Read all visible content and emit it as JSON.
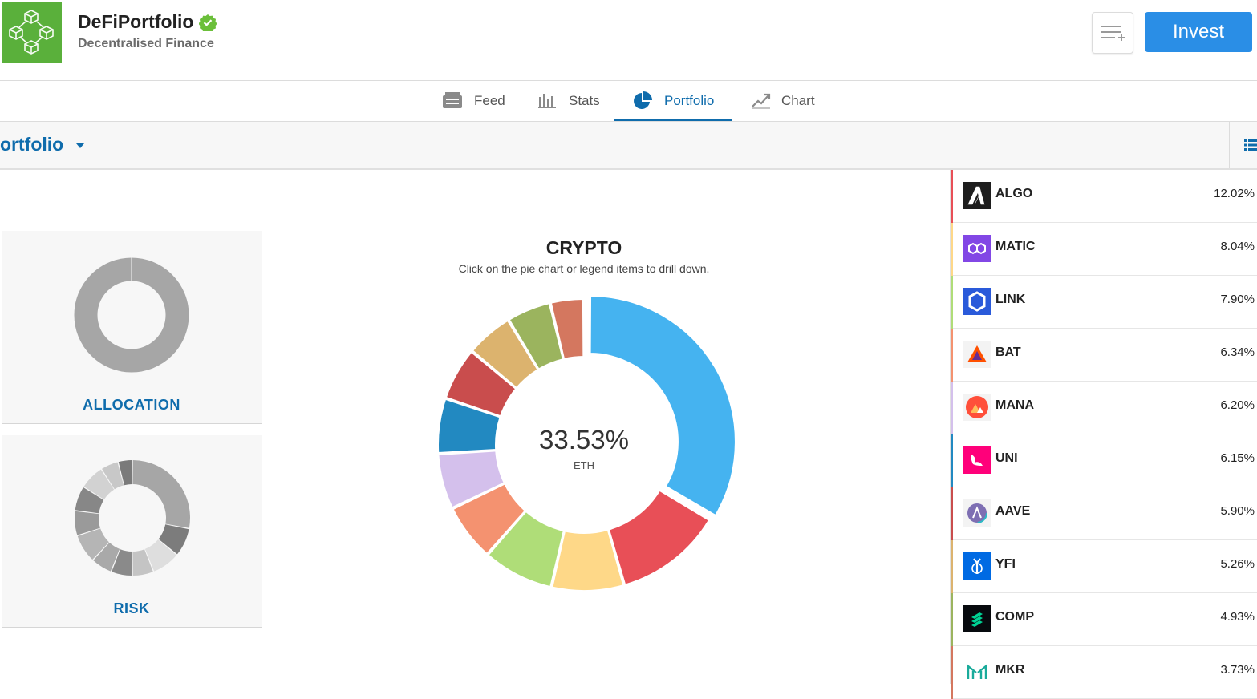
{
  "header": {
    "title": "DeFiPortfolio",
    "subtitle": "Decentralised Finance",
    "invest_label": "Invest",
    "logo_icon": "blockchain-cubes-icon",
    "verified_icon": "verified-check-icon",
    "watchlist_icon": "add-to-list-icon"
  },
  "tabs": [
    {
      "label": "Feed",
      "icon": "feed-icon"
    },
    {
      "label": "Stats",
      "icon": "stats-bars-icon"
    },
    {
      "label": "Portfolio",
      "icon": "pie-icon",
      "active": true
    },
    {
      "label": "Chart",
      "icon": "chart-line-icon"
    }
  ],
  "toolbar": {
    "selector_label": "ortfolio",
    "list_icon": "list-view-icon"
  },
  "cards": {
    "allocation_label": "ALLOCATION",
    "risk_label": "RISK"
  },
  "chart": {
    "title": "CRYPTO",
    "subtitle": "Click on the pie chart or legend items to drill down.",
    "center_value": "33.53%",
    "center_label": "ETH"
  },
  "chart_data": {
    "type": "pie",
    "title": "CRYPTO",
    "categories": [
      "ETH",
      "ALGO",
      "MATIC",
      "LINK",
      "BAT",
      "MANA",
      "UNI",
      "AAVE",
      "YFI",
      "COMP",
      "MKR"
    ],
    "values": [
      33.53,
      12.02,
      8.04,
      7.9,
      6.34,
      6.2,
      6.15,
      5.9,
      5.26,
      4.93,
      3.73
    ],
    "colors": [
      "#45b3f0",
      "#e84f57",
      "#fed888",
      "#afdd78",
      "#f49270",
      "#d4c0ec",
      "#2289c1",
      "#c94d4d",
      "#dcb36e",
      "#9bb45e",
      "#d4775f"
    ]
  },
  "holdings": [
    {
      "symbol": "ALGO",
      "pct": "12.02%",
      "icon": "algo-icon",
      "color": "#e84f57"
    },
    {
      "symbol": "MATIC",
      "pct": "8.04%",
      "icon": "matic-icon",
      "color": "#fed888"
    },
    {
      "symbol": "LINK",
      "pct": "7.90%",
      "icon": "link-icon",
      "color": "#afdd78"
    },
    {
      "symbol": "BAT",
      "pct": "6.34%",
      "icon": "bat-icon",
      "color": "#f49270"
    },
    {
      "symbol": "MANA",
      "pct": "6.20%",
      "icon": "mana-icon",
      "color": "#d4c0ec"
    },
    {
      "symbol": "UNI",
      "pct": "6.15%",
      "icon": "uni-icon",
      "color": "#2289c1"
    },
    {
      "symbol": "AAVE",
      "pct": "5.90%",
      "icon": "aave-icon",
      "color": "#c94d4d"
    },
    {
      "symbol": "YFI",
      "pct": "5.26%",
      "icon": "yfi-icon",
      "color": "#dcb36e"
    },
    {
      "symbol": "COMP",
      "pct": "4.93%",
      "icon": "comp-icon",
      "color": "#9bb45e"
    },
    {
      "symbol": "MKR",
      "pct": "3.73%",
      "icon": "mkr-icon",
      "color": "#d4775f"
    }
  ]
}
